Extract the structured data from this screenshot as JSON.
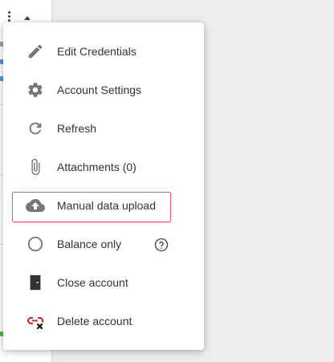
{
  "menu": {
    "items": [
      {
        "label": "Edit Credentials",
        "icon": "pencil-icon"
      },
      {
        "label": "Account Settings",
        "icon": "gear-icon"
      },
      {
        "label": "Refresh",
        "icon": "refresh-icon"
      },
      {
        "label": "Attachments (0)",
        "icon": "paperclip-icon"
      },
      {
        "label": "Manual data upload",
        "icon": "cloud-upload-icon"
      },
      {
        "label": "Balance only",
        "icon": "radio-empty-icon"
      },
      {
        "label": "Close account",
        "icon": "door-icon"
      },
      {
        "label": "Delete account",
        "icon": "unlink-delete-icon"
      }
    ],
    "help_icon": "help-circle-icon",
    "highlighted_item": "Manual data upload"
  },
  "colors": {
    "icon_gray": "#757575",
    "text": "#333333",
    "highlight_border": "#e0626d",
    "delete_icon_red": "#c62828"
  }
}
